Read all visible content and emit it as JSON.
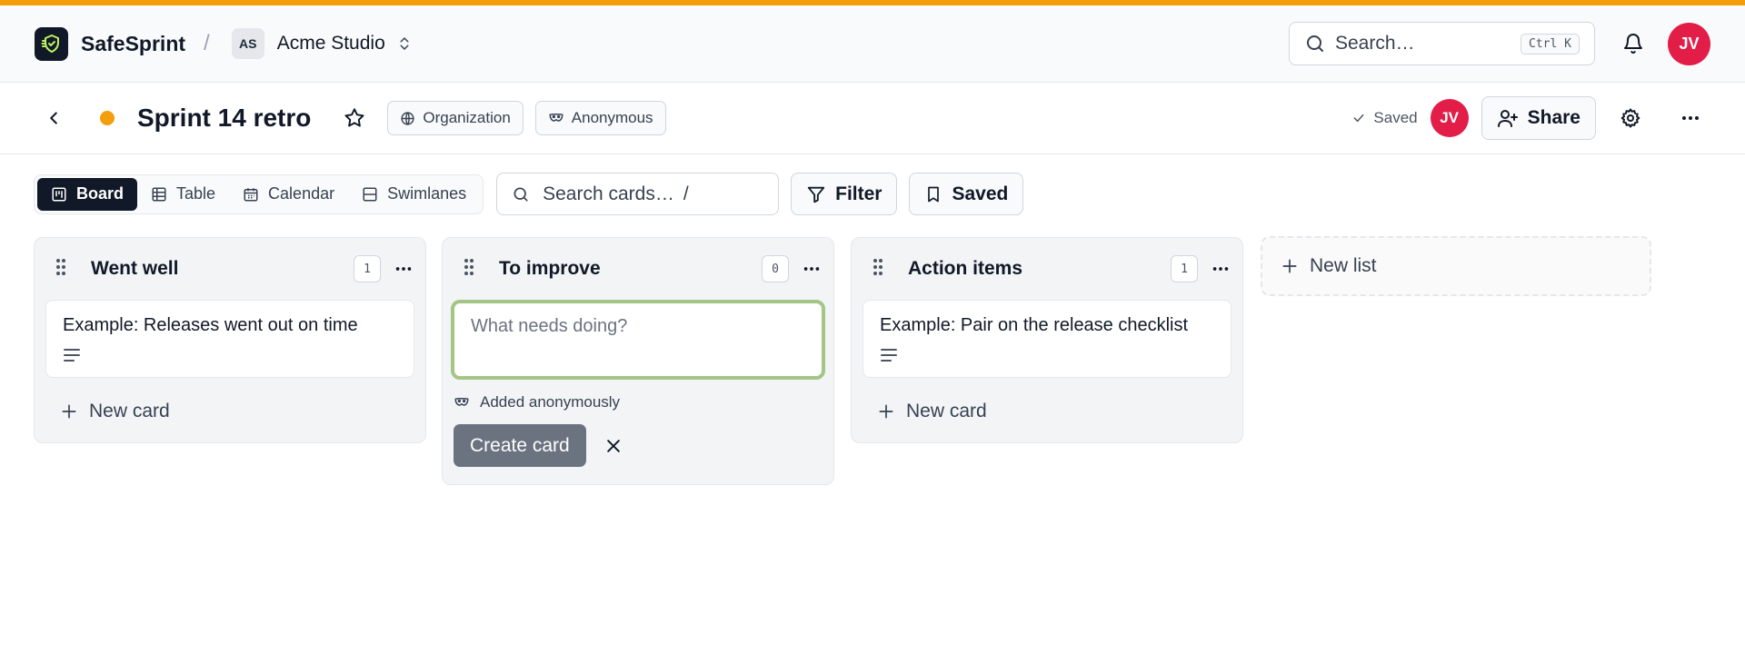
{
  "colors": {
    "accent": "#f59e0b",
    "avatar": "#e11d48",
    "composer_border": "#a3c585",
    "primary_dark": "#111827"
  },
  "topbar": {
    "brand": "SafeSprint",
    "separator": "/",
    "workspace_initials": "AS",
    "workspace_name": "Acme Studio",
    "search_placeholder": "Search…",
    "search_shortcut": "Ctrl K",
    "user_initials": "JV"
  },
  "header": {
    "title": "Sprint 14 retro",
    "visibility_label": "Organization",
    "identity_label": "Anonymous",
    "save_status": "Saved",
    "user_initials": "JV",
    "share_label": "Share"
  },
  "toolbar": {
    "views": [
      {
        "label": "Board",
        "icon": "board-icon",
        "active": true
      },
      {
        "label": "Table",
        "icon": "table-icon",
        "active": false
      },
      {
        "label": "Calendar",
        "icon": "calendar-icon",
        "active": false
      },
      {
        "label": "Swimlanes",
        "icon": "swimlanes-icon",
        "active": false
      }
    ],
    "card_search_placeholder": "Search cards…",
    "card_search_shortcut": "/",
    "filter_label": "Filter",
    "saved_label": "Saved"
  },
  "lists": [
    {
      "title": "Went well",
      "count": "1",
      "cards": [
        "Example: Releases went out on time"
      ],
      "new_card_label": "New card"
    },
    {
      "title": "To improve",
      "count": "0",
      "composer": {
        "placeholder": "What needs doing?",
        "note": "Added anonymously",
        "create_label": "Create card"
      }
    },
    {
      "title": "Action items",
      "count": "1",
      "cards": [
        "Example: Pair on the release checklist"
      ],
      "new_card_label": "New card"
    }
  ],
  "new_list_label": "New list"
}
